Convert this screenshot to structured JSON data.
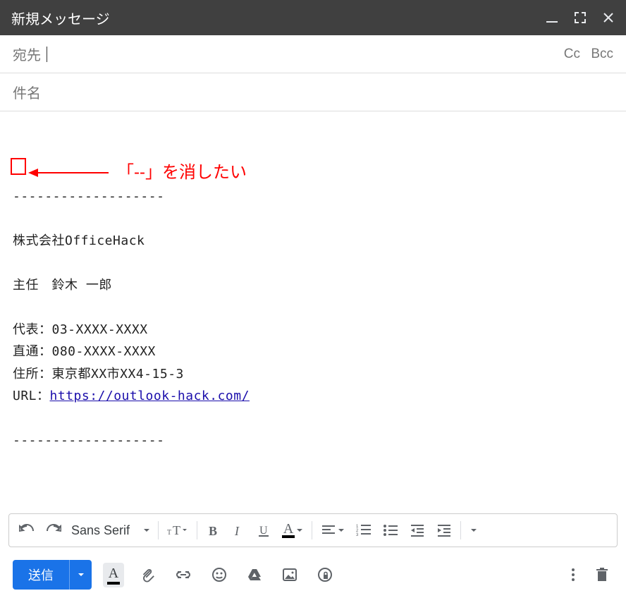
{
  "titlebar": {
    "title": "新規メッセージ"
  },
  "fields": {
    "to_label": "宛先",
    "cc_label": "Cc",
    "bcc_label": "Bcc",
    "subject_label": "件名"
  },
  "body": {
    "dashes": "--",
    "divider": "-------------------",
    "company": "株式会社OfficeHack",
    "role_name": "主任　鈴木 一郎",
    "phone_main": "代表：03-XXXX-XXXX",
    "phone_direct": "直通：080-XXXX-XXXX",
    "address": "住所：東京都XX市XX4-15-3",
    "url_prefix": "URL：",
    "url": "https://outlook-hack.com/"
  },
  "annotation": {
    "text": "「--」を消したい"
  },
  "toolbar": {
    "font_name": "Sans Serif"
  },
  "actions": {
    "send_label": "送信"
  }
}
